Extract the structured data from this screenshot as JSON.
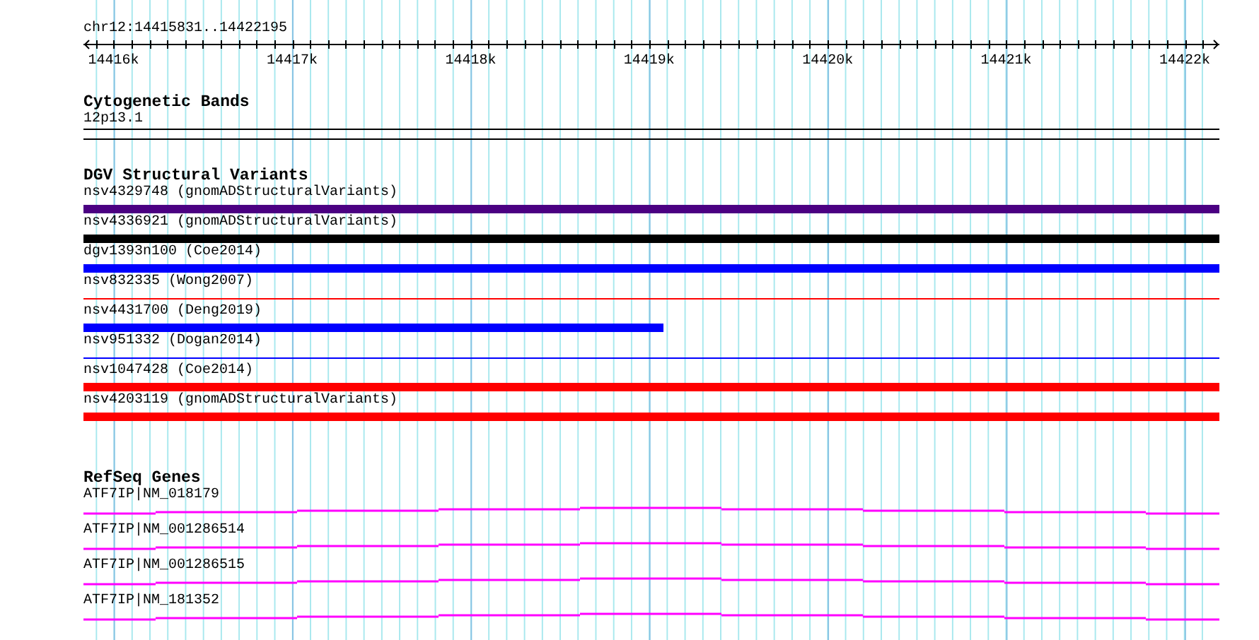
{
  "location": "chr12:14415831..14422195",
  "ruler": {
    "ticks": [
      "14416k",
      "14417k",
      "14418k",
      "14419k",
      "14420k",
      "14421k",
      "14422k"
    ]
  },
  "tracks": [
    {
      "kind": "cytoband",
      "title": "Cytogenetic Bands",
      "features": [
        {
          "label": "12p13.1"
        }
      ]
    },
    {
      "kind": "variants",
      "title": "DGV Structural Variants",
      "features": [
        {
          "label": "nsv4329748 (gnomADStructuralVariants)",
          "kind": "thick",
          "color": "#4b0082",
          "level": 1
        },
        {
          "label": "nsv4336921 (gnomADStructuralVariants)",
          "kind": "thick",
          "color": "#000000",
          "level": 1
        },
        {
          "label": "dgv1393n100 (Coe2014)",
          "kind": "thick",
          "color": "#0000ff",
          "level": 1
        },
        {
          "label": "nsv832335 (Wong2007)",
          "kind": "thin",
          "color": "#ff0000",
          "level": 1
        },
        {
          "label": "nsv4431700 (Deng2019)",
          "kind": "thick",
          "color": "#0000ff",
          "level": 0.51
        },
        {
          "label": "nsv951332 (Dogan2014)",
          "kind": "thin",
          "color": "#0000ff",
          "level": 1
        },
        {
          "label": "nsv1047428 (Coe2014)",
          "kind": "thick",
          "color": "#ff0000",
          "level": 1
        },
        {
          "label": "nsv4203119 (gnomADStructuralVariants)",
          "kind": "thick",
          "color": "#ff0000",
          "level": 1
        }
      ]
    },
    {
      "kind": "genes",
      "title": "RefSeq Genes",
      "features": [
        {
          "label": "ATF7IP|NM_018179"
        },
        {
          "label": "ATF7IP|NM_001286514"
        },
        {
          "label": "ATF7IP|NM_001286515"
        },
        {
          "label": "ATF7IP|NM_181352"
        }
      ]
    }
  ]
}
